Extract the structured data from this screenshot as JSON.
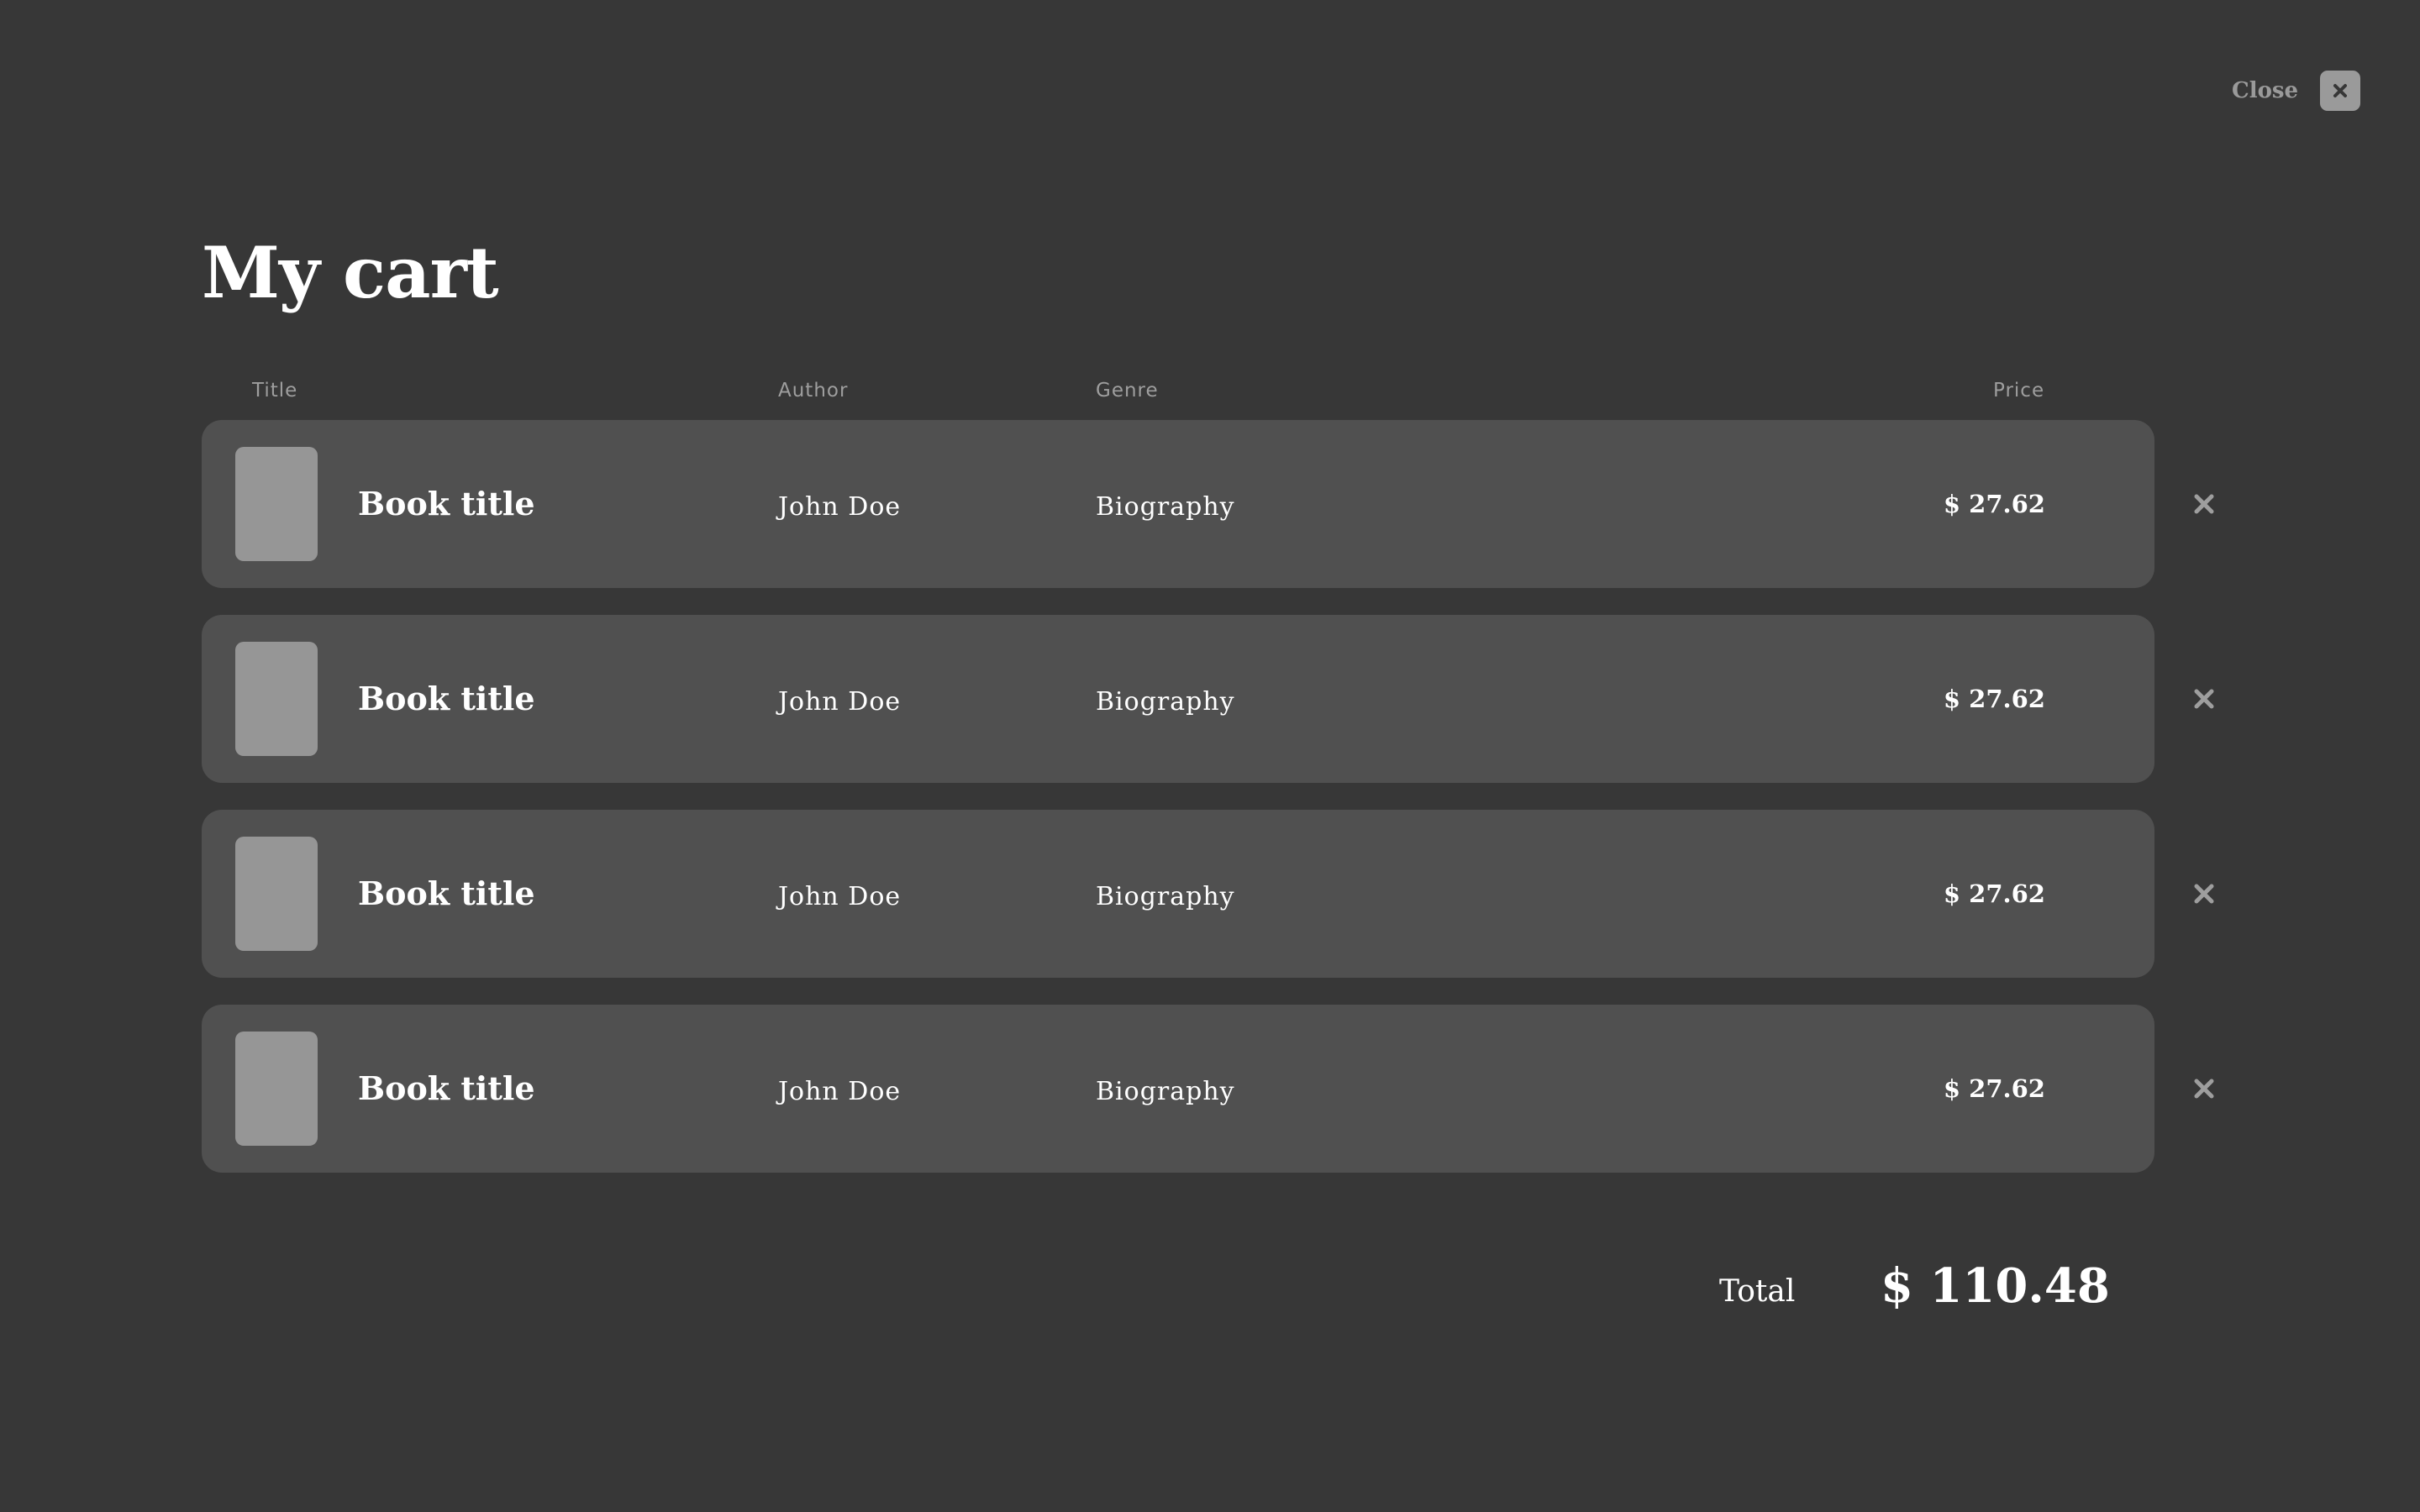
{
  "close": {
    "label": "Close",
    "icon": "close-icon"
  },
  "page_title": "My cart",
  "columns": {
    "title": "Title",
    "author": "Author",
    "genre": "Genre",
    "price": "Price"
  },
  "items": [
    {
      "title": "Book title",
      "author": "John Doe",
      "genre": "Biography",
      "price": "$ 27.62"
    },
    {
      "title": "Book title",
      "author": "John Doe",
      "genre": "Biography",
      "price": "$ 27.62"
    },
    {
      "title": "Book title",
      "author": "John Doe",
      "genre": "Biography",
      "price": "$ 27.62"
    },
    {
      "title": "Book title",
      "author": "John Doe",
      "genre": "Biography",
      "price": "$ 27.62"
    }
  ],
  "total": {
    "label": "Total",
    "value": "$ 110.48"
  },
  "colors": {
    "background": "#373737",
    "row": "#505050",
    "cover_placeholder": "#969696",
    "muted": "#9e9e9e"
  }
}
